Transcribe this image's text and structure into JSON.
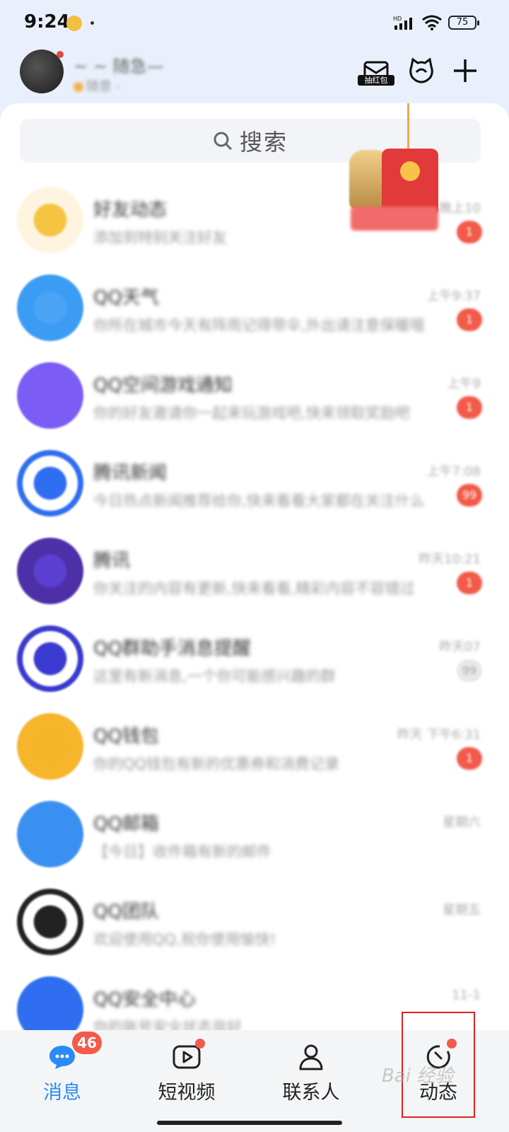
{
  "status_bar": {
    "time": "9:24",
    "network": "HD",
    "battery": "75"
  },
  "header": {
    "nickname": "~ ~ 随急—",
    "status_text": "随意 -",
    "redpack_label": "抽红包"
  },
  "search": {
    "placeholder": "搜索"
  },
  "conversations": [
    {
      "title": "好友动态",
      "preview": "添加到特别关注好友",
      "time": "晚上10",
      "badge": "1",
      "color": "#f5c542",
      "avatar_bg": "#fff4e0"
    },
    {
      "title": "QQ天气",
      "preview": "你所在城市今天有阵雨记得带伞,外出请注意保暖哦",
      "time": "上午9:37",
      "badge": "1",
      "color": "#4aa3f5",
      "avatar_bg": "#3b9cf3"
    },
    {
      "title": "QQ空间游戏通知",
      "preview": "你的好友邀请你一起来玩游戏吧,快来领取奖励吧",
      "time": "上午9",
      "badge": "1",
      "color": "#7b5cf5",
      "avatar_bg": "#7b5cf5"
    },
    {
      "title": "腾讯新闻",
      "preview": "今日热点新闻推荐给你,快来看看大家都在关注什么吧",
      "time": "上午7:08",
      "badge": "99",
      "color": "#2f6ef0",
      "avatar_bg": "#ffffff"
    },
    {
      "title": "腾讯",
      "preview": "你关注的内容有更新,快来看看,精彩内容不容错过",
      "time": "昨天10:21",
      "badge": "1",
      "color": "#5b3fd1",
      "avatar_bg": "#4d2fa8"
    },
    {
      "title": "QQ群助手消息提醒",
      "preview": "这里有新消息,一个你可能感兴趣的群",
      "time": "昨天07",
      "badge": "99",
      "muted": true,
      "color": "#3a3ad0",
      "avatar_bg": "#ffffff"
    },
    {
      "title": "QQ钱包",
      "preview": "你的QQ钱包有新的优惠券和消费记录",
      "time": "昨天 下午6:31",
      "badge": "1",
      "color": "#f5b52a",
      "avatar_bg": "#f6b52b"
    },
    {
      "title": "QQ邮箱",
      "preview": "【今日】收件箱有新的邮件",
      "time": "星期六",
      "badge": "",
      "color": "#3a90f0",
      "avatar_bg": "#3a90f0"
    },
    {
      "title": "QQ团队",
      "preview": "欢迎使用QQ,祝你使用愉快!",
      "time": "星期五",
      "badge": "",
      "color": "#222222",
      "avatar_bg": "#ffffff"
    },
    {
      "title": "QQ安全中心",
      "preview": "你的账号安全状态良好",
      "time": "11-1",
      "badge": "",
      "color": "#2f6ef0",
      "avatar_bg": "#2f6ef0"
    }
  ],
  "bottom_nav": {
    "messages": {
      "label": "消息",
      "badge": "46"
    },
    "short_video": {
      "label": "短视频"
    },
    "contacts": {
      "label": "联系人"
    },
    "moments": {
      "label": "动态"
    }
  },
  "watermark": "Bai 经验",
  "colors": {
    "accent": "#2b8af7",
    "badge": "#f25a4a",
    "background": "#eaf0fb"
  }
}
